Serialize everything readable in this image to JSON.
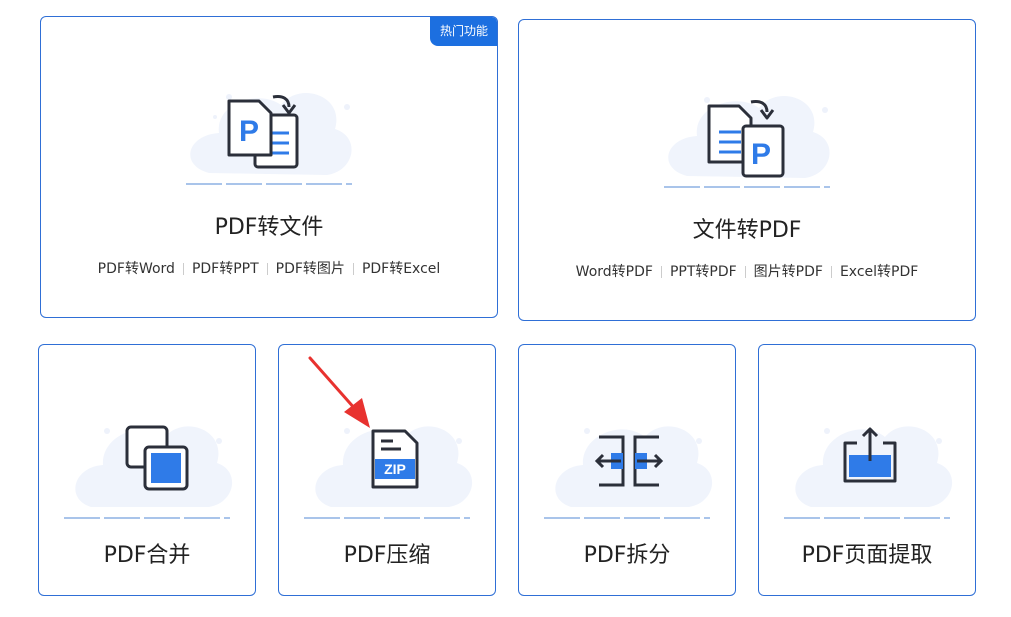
{
  "cards": {
    "pdf_to_file": {
      "badge": "热门功能",
      "title": "PDF转文件",
      "subs": [
        "PDF转Word",
        "PDF转PPT",
        "PDF转图片",
        "PDF转Excel"
      ]
    },
    "file_to_pdf": {
      "title": "文件转PDF",
      "subs": [
        "Word转PDF",
        "PPT转PDF",
        "图片转PDF",
        "Excel转PDF"
      ]
    },
    "merge": {
      "title": "PDF合并"
    },
    "compress": {
      "title": "PDF压缩",
      "icon_text": "ZIP"
    },
    "split": {
      "title": "PDF拆分"
    },
    "extract": {
      "title": "PDF页面提取"
    }
  },
  "icons": {
    "doc_letter": "P"
  },
  "colors": {
    "accent": "#2f6fd6",
    "icon_blue": "#2f7be8",
    "dark_stroke": "#2b2f3a",
    "annotation_red": "#e8322f"
  }
}
